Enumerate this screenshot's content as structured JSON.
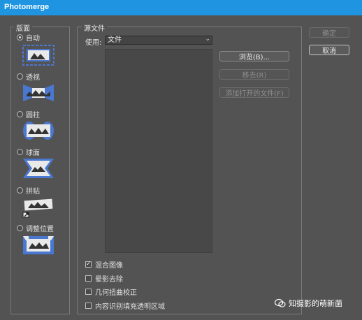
{
  "window": {
    "title": "Photomerge"
  },
  "layout_panel": {
    "legend": "版面",
    "options": [
      {
        "label": "自动",
        "selected": true,
        "icon": "layout-auto-icon"
      },
      {
        "label": "透视",
        "selected": false,
        "icon": "layout-perspective-icon"
      },
      {
        "label": "圆柱",
        "selected": false,
        "icon": "layout-cylindrical-icon"
      },
      {
        "label": "球面",
        "selected": false,
        "icon": "layout-spherical-icon"
      },
      {
        "label": "拼贴",
        "selected": false,
        "icon": "layout-collage-icon"
      },
      {
        "label": "调整位置",
        "selected": false,
        "icon": "layout-reposition-icon"
      }
    ]
  },
  "source_panel": {
    "legend": "源文件",
    "use_label": "使用:",
    "use_value": "文件",
    "browse_button": "浏览(B)...",
    "remove_button": "移去(R)",
    "add_open_button": "添加打开的文件(F)"
  },
  "options": {
    "blend_images": {
      "label": "混合图像",
      "checked": true
    },
    "vignette_removal": {
      "label": "晕影去除",
      "checked": false
    },
    "geometric_distortion": {
      "label": "几何扭曲校正",
      "checked": false
    },
    "content_aware_fill": {
      "label": "内容识别填充透明区域",
      "checked": false
    }
  },
  "dialog_buttons": {
    "ok": "确定",
    "cancel": "取消"
  },
  "watermark": {
    "text": "知摄影的萌新菌"
  },
  "colors": {
    "titlebar": "#1f95e2",
    "panel": "#535353",
    "accent_icon": "#4a78d0"
  }
}
